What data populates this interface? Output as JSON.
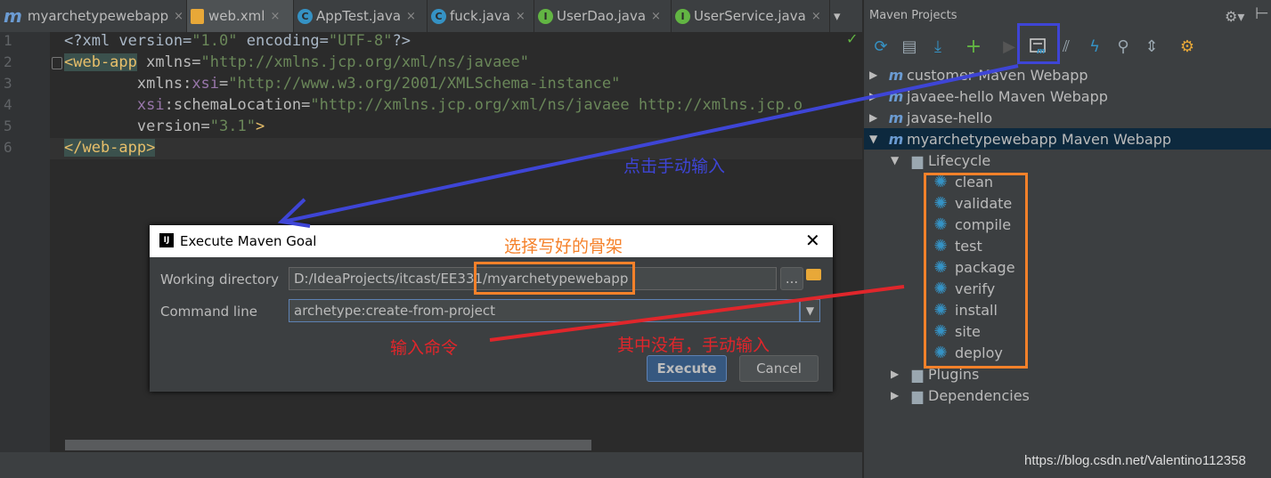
{
  "editor_tabs": [
    {
      "label": "myarchetypewebapp",
      "icon": "maven-m-icon",
      "active": false
    },
    {
      "label": "web.xml",
      "icon": "xml-file-icon",
      "active": true
    },
    {
      "label": "AppTest.java",
      "icon": "class-icon",
      "active": false
    },
    {
      "label": "fuck.java",
      "icon": "class-icon",
      "active": false
    },
    {
      "label": "UserDao.java",
      "icon": "interface-icon",
      "active": false
    },
    {
      "label": "UserService.java",
      "icon": "interface-icon",
      "active": false
    }
  ],
  "tab_overflow": "▾",
  "line_numbers": [
    "1",
    "2",
    "3",
    "4",
    "5",
    "6"
  ],
  "code": {
    "l1_a": "<?xml version=",
    "l1_b": "\"1.0\"",
    "l1_c": " encoding=",
    "l1_d": "\"UTF-8\"",
    "l1_e": "?>",
    "l2_tag": "<web-app",
    "l2_attr": " xmlns=",
    "l2_val": "\"http://xmlns.jcp.org/xml/ns/javaee\"",
    "l3_indent": "        ",
    "l3_ns": "xmlns:",
    "l3_xsi": "xsi",
    "l3_eq": "=",
    "l3_val": "\"http://www.w3.org/2001/XMLSchema-instance\"",
    "l4_indent": "        ",
    "l4_xsi": "xsi",
    "l4_attr": ":schemaLocation=",
    "l4_val": "\"http://xmlns.jcp.org/xml/ns/javaee http://xmlns.jcp.o",
    "l5_indent": "        ",
    "l5_attr": "version=",
    "l5_val": "\"3.1\"",
    "l5_end": ">",
    "l6_tag": "</web-app>"
  },
  "maven": {
    "title": "Maven Projects",
    "projects": [
      {
        "label": "customer Maven Webapp",
        "expanded": false
      },
      {
        "label": "javaee-hello Maven Webapp",
        "expanded": false
      },
      {
        "label": "javase-hello",
        "expanded": false
      },
      {
        "label": "myarchetypewebapp Maven Webapp",
        "expanded": true
      }
    ],
    "lifecycle_label": "Lifecycle",
    "lifecycle": [
      "clean",
      "validate",
      "compile",
      "test",
      "package",
      "verify",
      "install",
      "site",
      "deploy"
    ],
    "plugins_label": "Plugins",
    "dependencies_label": "Dependencies"
  },
  "dialog": {
    "title": "Execute Maven Goal",
    "working_directory_label": "Working directory",
    "working_directory_value": "D:/IdeaProjects/itcast/EE331/myarchetypewebapp",
    "command_line_label": "Command line",
    "command_line_value": "archetype:create-from-project",
    "browse_label": "...",
    "execute_label": "Execute",
    "cancel_label": "Cancel"
  },
  "annotations": {
    "click_manual_input": "点击手动输入",
    "select_archetype": "选择写好的骨架",
    "enter_command": "输入命令",
    "none_manual_input": "其中没有，手动输入",
    "blue_color": "#3e45d6",
    "orange_color": "#f5812a",
    "red_color": "#e0262b"
  },
  "watermark": "https://blog.csdn.net/Valentino112358"
}
